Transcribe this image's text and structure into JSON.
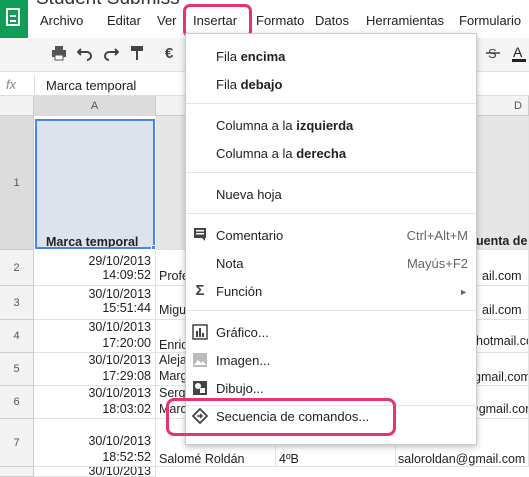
{
  "title": "Student Submiss",
  "menubar": [
    "Archivo",
    "Editar",
    "Ver",
    "Insertar",
    "Formato",
    "Datos",
    "Herramientas",
    "Formulario"
  ],
  "formula": {
    "fx": "fx",
    "value": "Marca temporal"
  },
  "columns": [
    "A",
    "D"
  ],
  "rows": [
    "1",
    "2",
    "3",
    "4",
    "5",
    "6",
    "7"
  ],
  "sheet": {
    "header": {
      "a": "Marca temporal",
      "d": "uenta de"
    },
    "data": [
      {
        "date": "29/10/2013",
        "time": "14:09:52",
        "b": "Profe",
        "d": "ail.com"
      },
      {
        "date": "30/10/2013",
        "time": "15:51:44",
        "b": "Migu",
        "d": "ail.com"
      },
      {
        "date": "30/10/2013",
        "time": "17:20:00",
        "b": "Enric",
        "d": "hotmail.com"
      },
      {
        "date": "30/10/2013",
        "time": "17:29:08",
        "b": "Aleja",
        "b2": "Marg",
        "d": "gmail.com"
      },
      {
        "date": "30/10/2013",
        "time": "18:03:02",
        "b": "Sergi",
        "b2": "Marc",
        "d": "@gmail.com"
      },
      {
        "date": "30/10/2013",
        "time": "18:52:52",
        "b": "Salomé Roldán",
        "c": "4ºB",
        "d": "saloroldan@gmail.com"
      },
      {
        "date": "30/10/2013",
        "time": ""
      }
    ]
  },
  "dropdown": {
    "fila_encima_pre": "Fila ",
    "fila_encima_b": "encima",
    "fila_debajo_pre": "Fila ",
    "fila_debajo_b": "debajo",
    "col_izq_pre": "Columna a la ",
    "col_izq_b": "izquierda",
    "col_der_pre": "Columna a la ",
    "col_der_b": "derecha",
    "nueva_hoja": "Nueva hoja",
    "comentario": "Comentario",
    "comentario_sc": "Ctrl+Alt+M",
    "nota": "Nota",
    "nota_sc": "Mayús+F2",
    "funcion": "Función",
    "grafico": "Gráfico...",
    "imagen": "Imagen...",
    "dibujo": "Dibujo...",
    "script": "Secuencia de comandos..."
  },
  "icons": {
    "comment": "comment-icon",
    "sigma": "sigma-icon",
    "chart": "chart-icon",
    "image": "image-icon",
    "drawing": "drawing-icon",
    "script": "script-icon"
  },
  "colors": {
    "highlight": "#e8336b",
    "selection": "#4a86e8",
    "logo": "#0f9d58"
  }
}
